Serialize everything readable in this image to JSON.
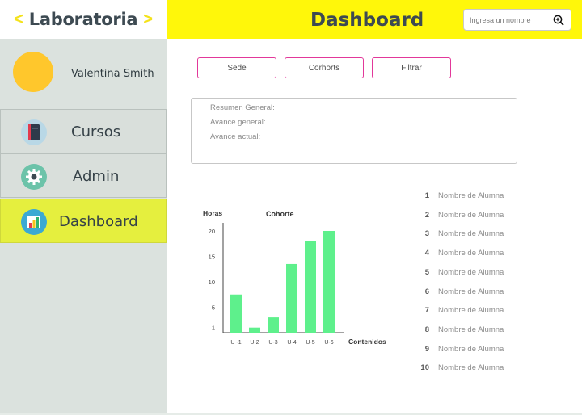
{
  "brand": {
    "title": "Laboratoria",
    "left_arrow": "<",
    "right_arrow": ">"
  },
  "user": {
    "name": "Valentina Smith"
  },
  "sidebar": {
    "items": [
      {
        "label": "Cursos",
        "icon": "notebook-icon",
        "active": false
      },
      {
        "label": "Admin",
        "icon": "gear-icon",
        "active": false
      },
      {
        "label": "Dashboard",
        "icon": "bar-chart-icon",
        "active": true
      }
    ]
  },
  "header": {
    "title": "Dashboard"
  },
  "search": {
    "placeholder": "Ingresa un nombre",
    "icon": "zoom-in-icon"
  },
  "filters": [
    "Sede",
    "Corhorts",
    "Filtrar"
  ],
  "summary": {
    "general": "Resumen General:",
    "progress": "Avance general:",
    "current": "Avance actual:"
  },
  "chart_data": {
    "type": "bar",
    "title": "Cohorte",
    "xlabel": "Contenidos",
    "ylabel": "Horas",
    "categories": [
      "U -1",
      "U-2",
      "U-3",
      "U-4",
      "U-5",
      "U-6"
    ],
    "values": [
      7.5,
      1,
      3,
      13.5,
      18,
      20
    ],
    "yticks": [
      1,
      5,
      10,
      15,
      20
    ],
    "ylim": [
      0,
      22
    ],
    "color": "#5ef08c",
    "grid": false
  },
  "ranking": [
    {
      "n": "1",
      "name": "Nombre de Alumna"
    },
    {
      "n": "2",
      "name": "Nombre de Alumna"
    },
    {
      "n": "3",
      "name": "Nombre de Alumna"
    },
    {
      "n": "4",
      "name": "Nombre de Alumna"
    },
    {
      "n": "5",
      "name": "Nombre de Alumna"
    },
    {
      "n": "6",
      "name": "Nombre de Alumna"
    },
    {
      "n": "7",
      "name": "Nombre de Alumna"
    },
    {
      "n": "8",
      "name": "Nombre de Alumna"
    },
    {
      "n": "9",
      "name": "Nombre de Alumna"
    },
    {
      "n": "10",
      "name": "Nombre de Alumna"
    }
  ],
  "colors": {
    "header": "#fff70a",
    "active_nav": "#e5ef3e",
    "accent_arrow": "#f4e21b",
    "button_border": "#e2389a",
    "avatar": "#ffc72c"
  }
}
